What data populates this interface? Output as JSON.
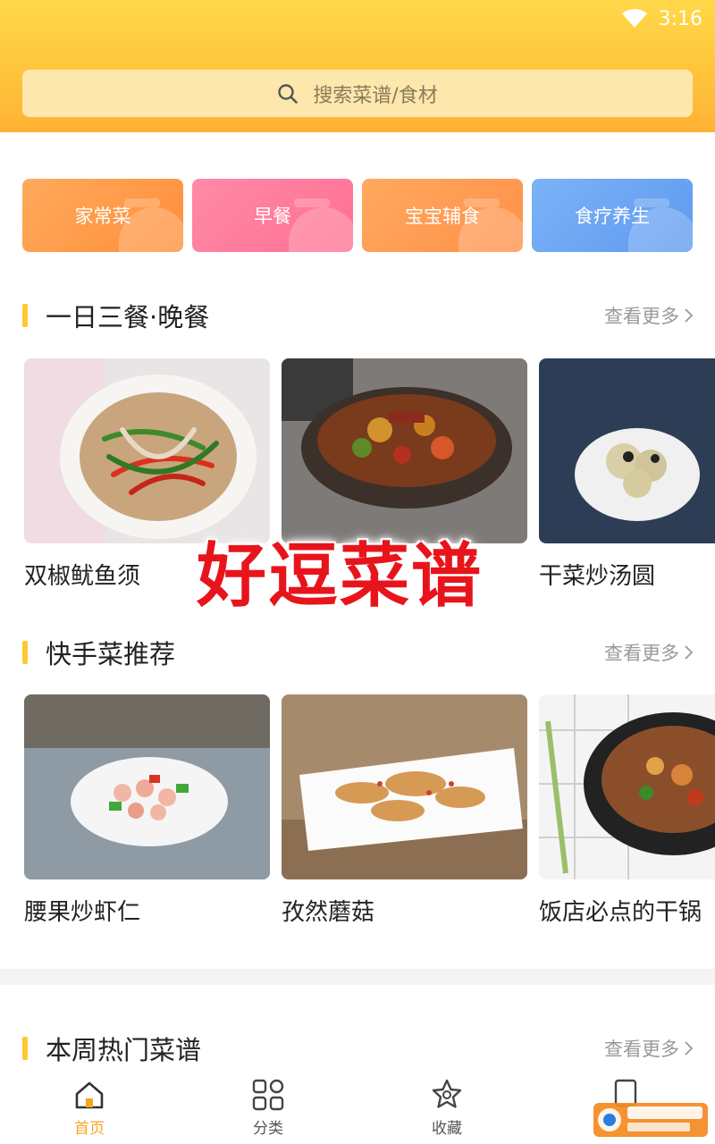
{
  "status_bar": {
    "time": "3:16",
    "wifi_icon": "wifi-icon"
  },
  "search": {
    "placeholder": "搜索菜谱/食材",
    "icon": "search-icon"
  },
  "categories": [
    {
      "label": "家常菜",
      "color": "#ff9a48"
    },
    {
      "label": "早餐",
      "color": "#ff7b9a"
    },
    {
      "label": "宝宝辅食",
      "color": "#ff9a52"
    },
    {
      "label": "食疗养生",
      "color": "#6aa4f4"
    }
  ],
  "sections": [
    {
      "title": "一日三餐·晚餐",
      "more": "查看更多",
      "items": [
        {
          "name": "双椒鱿鱼须"
        },
        {
          "name": ""
        },
        {
          "name": "干菜炒汤圆"
        }
      ]
    },
    {
      "title": "快手菜推荐",
      "more": "查看更多",
      "items": [
        {
          "name": "腰果炒虾仁"
        },
        {
          "name": "孜然蘑菇"
        },
        {
          "name": "饭店必点的干锅"
        }
      ]
    },
    {
      "title": "本周热门菜谱",
      "more": "查看更多"
    }
  ],
  "watermark": "好逗菜谱",
  "tabbar": [
    {
      "label": "首页",
      "icon": "home-icon",
      "active": true
    },
    {
      "label": "分类",
      "icon": "grid-icon",
      "active": false
    },
    {
      "label": "收藏",
      "icon": "star-icon",
      "active": false
    },
    {
      "label": "",
      "icon": "profile-icon",
      "active": false
    }
  ],
  "colors": {
    "accent": "#ffc832",
    "header": "#ffc23a",
    "active_tab": "#f5a623"
  }
}
